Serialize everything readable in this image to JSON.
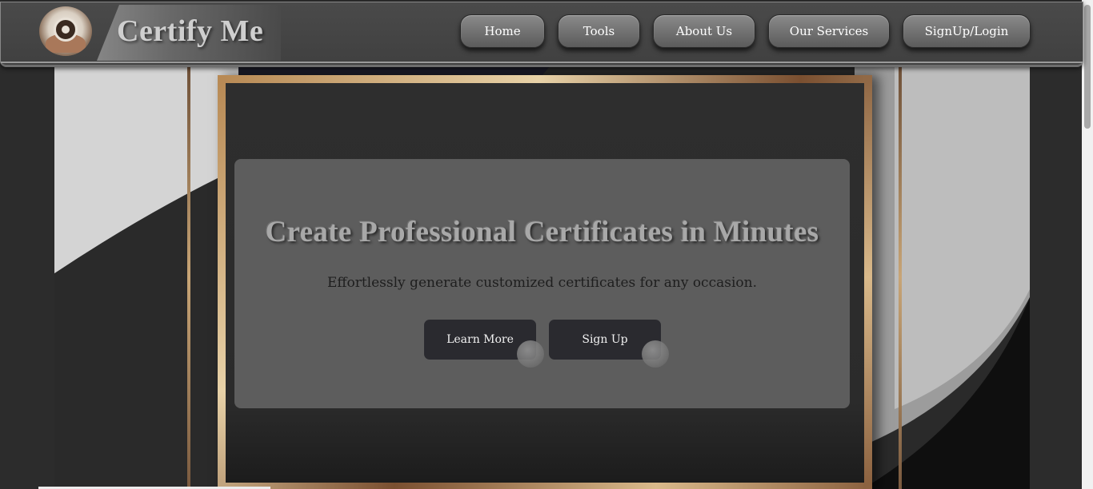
{
  "brand": {
    "name": "Certify Me",
    "logo_icon": "certificate-seal-logo"
  },
  "nav": {
    "items": [
      {
        "label": "Home"
      },
      {
        "label": "Tools"
      },
      {
        "label": "About Us"
      },
      {
        "label": "Our Services"
      },
      {
        "label": "SignUp/Login"
      }
    ]
  },
  "hero": {
    "title": "Create Professional Certificates in Minutes",
    "subtitle": "Effortlessly generate customized certificates for any occasion.",
    "learn_more_label": "Learn More",
    "sign_up_label": "Sign Up"
  },
  "colors": {
    "navbar": "#444444",
    "nav_button": "#6e6e6e",
    "panel": "#646464",
    "cta_button": "#2a2a2f",
    "frame_gold": "#c49a68"
  }
}
